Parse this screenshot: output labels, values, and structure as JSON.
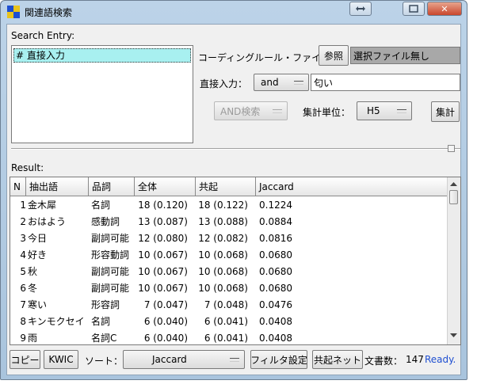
{
  "window": {
    "title": "関連語検索",
    "minimize_icon": "minimize-icon",
    "maximize_icon": "maximize-icon",
    "close_icon": "close-icon"
  },
  "search_entry": {
    "label": "Search Entry:",
    "items": [
      "# 直接入力"
    ]
  },
  "coding_rule": {
    "label": "コーディングルール・ファイル：",
    "browse_label": "参照",
    "file_value": "選択ファイル無し"
  },
  "direct_input": {
    "label": "直接入力：",
    "operator": "and",
    "value": "匂い"
  },
  "search_mode": {
    "value": "AND検索"
  },
  "unit": {
    "label": "集計単位：",
    "value": "H5"
  },
  "aggregate_button": "集計",
  "result": {
    "label": "Result:",
    "columns": [
      "N",
      "抽出語",
      "品詞",
      "全体",
      "共起",
      "Jaccard"
    ],
    "rows": [
      [
        "1",
        "金木犀",
        "名詞",
        "18 (0.120)",
        "18 (0.122)",
        "0.1224"
      ],
      [
        "2",
        "おはよう",
        "感動詞",
        "13 (0.087)",
        "13 (0.088)",
        "0.0884"
      ],
      [
        "3",
        "今日",
        "副詞可能",
        "12 (0.080)",
        "12 (0.082)",
        "0.0816"
      ],
      [
        "4",
        "好き",
        "形容動詞",
        "10 (0.067)",
        "10 (0.068)",
        "0.0680"
      ],
      [
        "5",
        "秋",
        "副詞可能",
        "10 (0.067)",
        "10 (0.068)",
        "0.0680"
      ],
      [
        "6",
        "冬",
        "副詞可能",
        "10 (0.067)",
        "10 (0.068)",
        "0.0680"
      ],
      [
        "7",
        "寒い",
        "形容詞",
        "7 (0.047)",
        "7 (0.048)",
        "0.0476"
      ],
      [
        "8",
        "キンモクセイ",
        "名詞",
        "6 (0.040)",
        "6 (0.041)",
        "0.0408"
      ],
      [
        "9",
        "雨",
        "名詞C",
        "6 (0.040)",
        "6 (0.041)",
        "0.0408"
      ]
    ]
  },
  "bottom": {
    "copy_label": "コピー",
    "kwic_label": "KWIC",
    "sort_label": "ソート：",
    "sort_value": "Jaccard",
    "filter_label": "フィルタ設定",
    "network_label": "共起ネット",
    "doc_count_label": "文書数：",
    "doc_count_value": "147",
    "status": "Ready."
  },
  "colors": {
    "selection": "#a8f0f0",
    "status_text": "#1f4fd1",
    "disabled_text": "#9a9a9a"
  }
}
